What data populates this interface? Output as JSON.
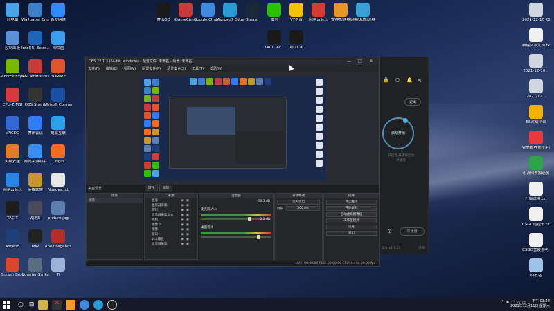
{
  "desktop": {
    "left_column": [
      {
        "label": "此电脑",
        "icon": "computer-icon",
        "color": "#4aa3e6"
      },
      {
        "label": "Wallpaper Engine：...",
        "icon": "wallpaper-engine-icon",
        "color": "#3d7fc9"
      },
      {
        "label": "百度网盘",
        "icon": "baidu-netdisk-icon",
        "color": "#2f8bff"
      },
      {
        "label": "控制面板",
        "icon": "control-panel-icon",
        "color": "#5b8fd6"
      },
      {
        "label": "Intel(R) Extre...",
        "icon": "intel-icon",
        "color": "#1f64b6"
      },
      {
        "label": "咪咕圈",
        "icon": "migu-icon",
        "color": "#3c9cf0"
      },
      {
        "label": "GeForce Experience",
        "icon": "geforce-icon",
        "color": "#76b900"
      },
      {
        "label": "MSI Afterburner",
        "icon": "msi-icon",
        "color": "#c93a3a"
      },
      {
        "label": "3DMark",
        "icon": "3dmark-icon",
        "color": "#e0562c"
      },
      {
        "label": "CPU-Z MSI",
        "icon": "cpuz-icon",
        "color": "#d43c3c"
      },
      {
        "label": "OBS Studio",
        "icon": "obs-icon",
        "color": "#333333"
      },
      {
        "label": "Ubisoft Connect",
        "icon": "ubisoft-icon",
        "color": "#1a4fa3"
      },
      {
        "label": "ePICDO",
        "icon": "epic-icon",
        "color": "#3367d6"
      },
      {
        "label": "腾讯会议",
        "icon": "tencent-meeting-icon",
        "color": "#2f7cf6"
      },
      {
        "label": "酷家互联",
        "icon": "kujia-icon",
        "color": "#2ca0e8"
      },
      {
        "label": "火绒安全",
        "icon": "huorong-icon",
        "color": "#e27b26"
      },
      {
        "label": "腾讯手游助手",
        "icon": "tencent-game-icon",
        "color": "#3b8df0"
      },
      {
        "label": "Origin",
        "icon": "origin-icon",
        "color": "#f36c21"
      },
      {
        "label": "网易云音乐",
        "icon": "netease-icon",
        "color": "#2b85e4"
      },
      {
        "label": "英雄联盟",
        "icon": "lol-icon",
        "color": "#c8962f"
      },
      {
        "label": "Nuages.txt",
        "icon": "text-file-icon",
        "color": "#e8e8e8"
      },
      {
        "label": "TACIT",
        "icon": "tacit-icon",
        "color": "#1d1d1d"
      },
      {
        "label": "战地5",
        "icon": "battlefield-icon",
        "color": "#4a4a5a"
      },
      {
        "label": "picture.jpg",
        "icon": "image-file-icon",
        "color": "#5a7fb0"
      },
      {
        "label": "Ascend",
        "icon": "ascend-icon",
        "color": "#1f3f7a"
      },
      {
        "label": "MW",
        "icon": "mw-icon",
        "color": "#222222"
      },
      {
        "label": "Apex Legends",
        "icon": "apex-icon",
        "color": "#b52c2c"
      },
      {
        "label": "Smash Bros",
        "icon": "smash-icon",
        "color": "#d6472b"
      },
      {
        "label": "Counter-Strike",
        "icon": "csgo-icon",
        "color": "#5a6c82"
      },
      {
        "label": "Ti",
        "icon": "ti-icon",
        "color": "#9bb3d6"
      }
    ],
    "top_row": [
      {
        "label": "腾讯QQ",
        "icon": "qq-icon",
        "color": "#1a1a1a"
      },
      {
        "label": "iGameCen...",
        "icon": "igame-icon",
        "color": "#c93a3a"
      },
      {
        "label": "Google Chrome",
        "icon": "chrome-icon",
        "color": "#3f8ae0"
      },
      {
        "label": "Microsoft Edge",
        "icon": "edge-icon",
        "color": "#2a9bd6"
      },
      {
        "label": "Steam",
        "icon": "steam-icon",
        "color": "#1b2838"
      },
      {
        "label": "微信",
        "icon": "wechat-icon",
        "color": "#2dc100"
      },
      {
        "label": "YY语音",
        "icon": "yy-icon",
        "color": "#f5c000"
      },
      {
        "label": "网易云音乐",
        "icon": "netease-music-icon",
        "color": "#d43c33"
      },
      {
        "label": "雷神加速器",
        "icon": "leishen-icon",
        "color": "#e8952a"
      },
      {
        "label": "网易UU加速器",
        "icon": "uu-icon",
        "color": "#3aa0d8"
      }
    ],
    "second_top": [
      {
        "label": "TACIT Ar...",
        "icon": "tacit-ar-icon",
        "color": "#1a1a1a"
      },
      {
        "label": "TACIT AC",
        "icon": "tacit-ac-icon",
        "color": "#1a1a1a"
      }
    ],
    "right_column": [
      {
        "label": "2021-12-10 21-12-17...",
        "icon": "video-file-icon",
        "color": "#cfd6e0"
      },
      {
        "label": "新建文本文档.txt",
        "icon": "text-file-icon",
        "color": "#f0f0f0"
      },
      {
        "label": "2021-12-10...",
        "icon": "video-file-icon",
        "color": "#cfd6e0"
      },
      {
        "label": "2021-12...",
        "icon": "video-file-icon",
        "color": "#cfd6e0"
      },
      {
        "label": "5E对战平台",
        "icon": "5e-icon",
        "color": "#f0b400"
      },
      {
        "label": "完美世界竞技平台",
        "icon": "perfect-world-icon",
        "color": "#e83a3a"
      },
      {
        "label": "迅游网游加速器",
        "icon": "xunyou-icon",
        "color": "#2ea34a"
      },
      {
        "label": "升级说明.txt",
        "icon": "text-file-icon",
        "color": "#f0f0f0"
      },
      {
        "label": "CSGO的提示.txt",
        "icon": "text-file-icon",
        "color": "#f0f0f0"
      },
      {
        "label": "CSGO重装说明.txt",
        "icon": "text-file-icon",
        "color": "#f0f0f0"
      },
      {
        "label": "回收站",
        "icon": "recycle-bin-icon",
        "color": "#9fc3e8"
      }
    ]
  },
  "obs": {
    "title": "OBS 27.1.3 (64-bit, windows) - 配置文件: 未命名 - 场景: 未命名",
    "menus": [
      "文件(F)",
      "编辑(E)",
      "视图(V)",
      "配置文件(P)",
      "场景集合(S)",
      "工具(T)",
      "帮助(H)"
    ],
    "scene_label": "来自预览",
    "tabs": [
      "属性",
      "滤镜"
    ],
    "panels": {
      "scenes": "场景",
      "sources": "来源",
      "mixer": "混音器",
      "transitions": "转场特效",
      "controls": "控件"
    },
    "scene_item": "场景",
    "sources": [
      "显示",
      "显示器采集",
      "游戏",
      "显示器采集文本",
      "视频",
      "图像 2",
      "图像",
      "窗口",
      "VLC播放",
      "显示器采集"
    ],
    "mixer": [
      {
        "name": "麦克风/Aux",
        "db": "-10.3 dB",
        "level": 0.72
      },
      {
        "name": "桌面音频",
        "db": "-2.2 dB",
        "level": 0.85
      }
    ],
    "transition": {
      "type": "淡入淡出",
      "duration_label": "时长",
      "duration_value": "300 ms"
    },
    "controls": [
      "停止推流",
      "开始录制",
      "启动虚拟摄像机",
      "工作室模式",
      "设置",
      "退出"
    ],
    "status": "LIVE: 00:00:00    REC: 00:00:00    CPU: 0.4%, 60.00 fps"
  },
  "side_app": {
    "button_logout": "退出",
    "ring_label": "启动开播",
    "hint_line1": "开启后,开播将启动",
    "hint_line2": "并推流",
    "bottom_btn": "加速器",
    "footer_left": "版本 v1.0.23",
    "footer_right": "开始"
  },
  "taskbar": {
    "time": "下午 03:44",
    "date": "2021年12月11日 星期六",
    "lang": "中"
  }
}
